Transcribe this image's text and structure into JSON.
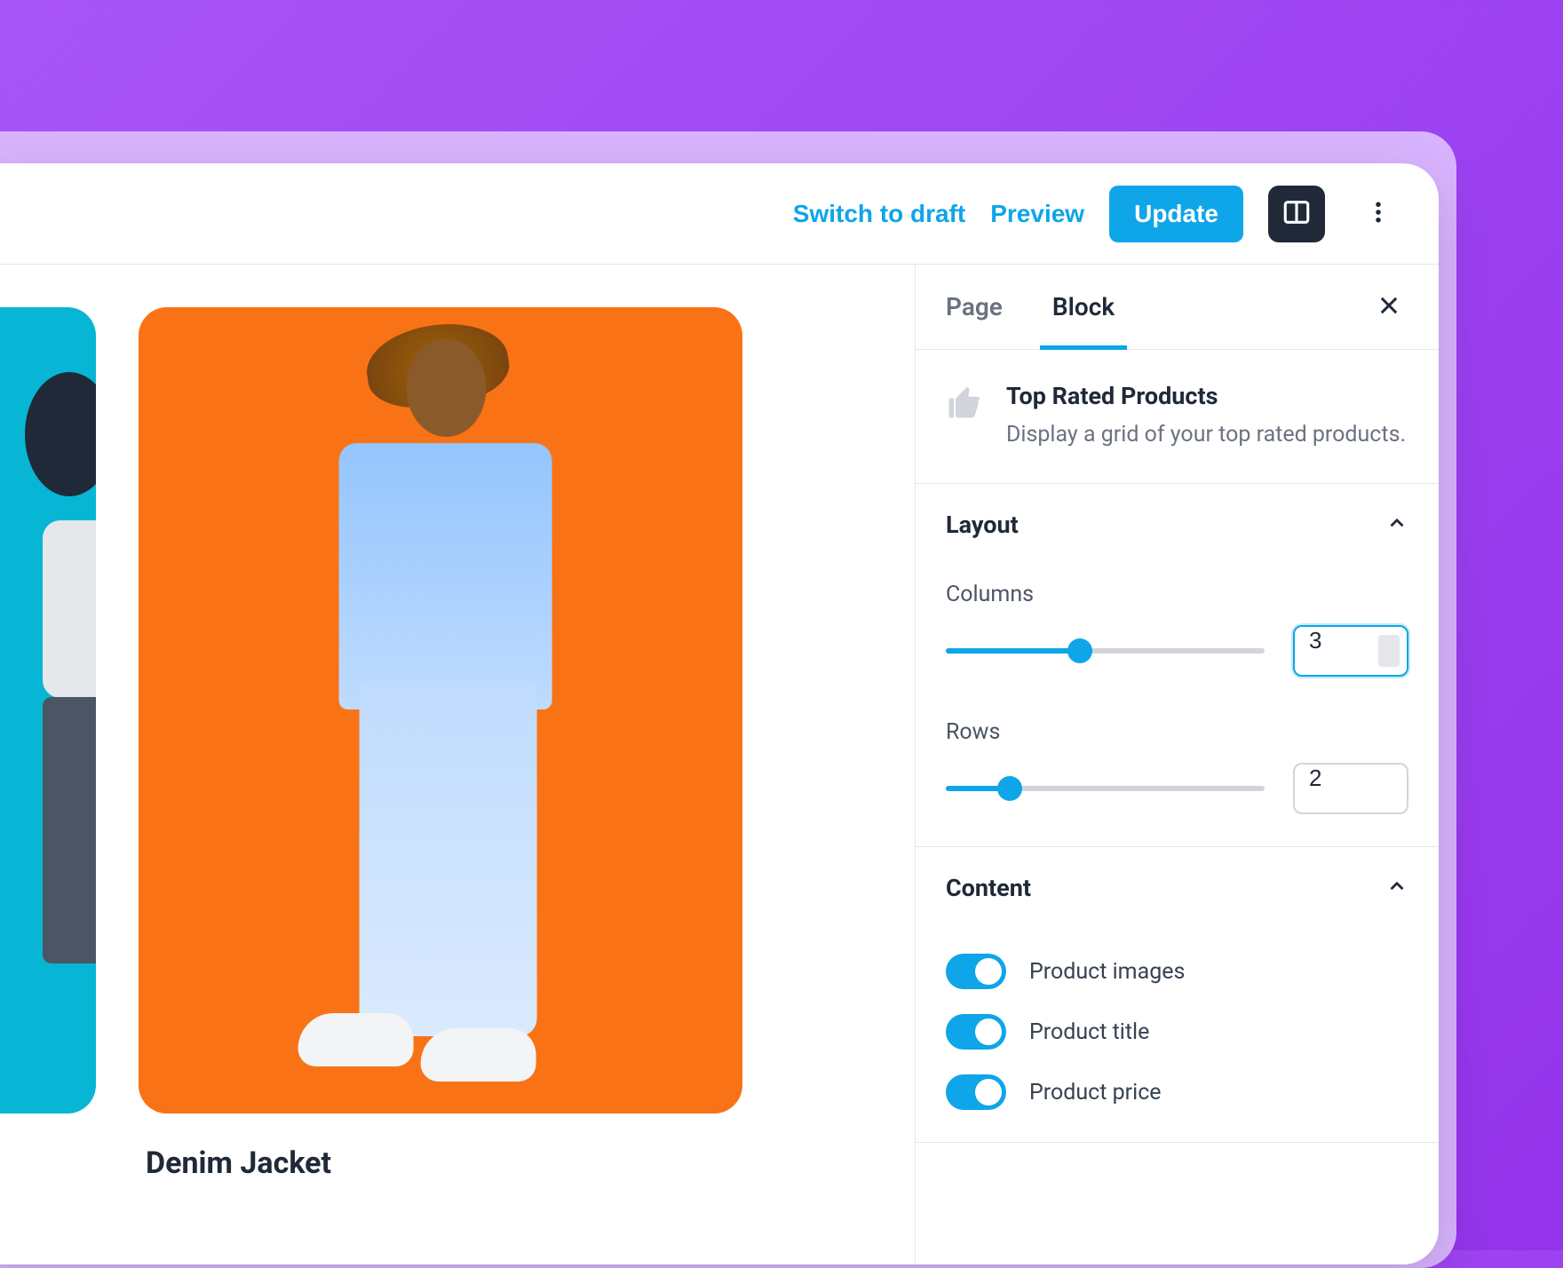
{
  "toolbar": {
    "switch_draft": "Switch to draft",
    "preview": "Preview",
    "update": "Update"
  },
  "tabs": {
    "page": "Page",
    "block": "Block"
  },
  "block": {
    "title": "Top Rated Products",
    "description": "Display a grid of your top rated products."
  },
  "sections": {
    "layout": {
      "title": "Layout",
      "columns_label": "Columns",
      "columns_value": "3",
      "rows_label": "Rows",
      "rows_value": "2"
    },
    "content": {
      "title": "Content",
      "toggles": [
        {
          "label": "Product images",
          "on": true
        },
        {
          "label": "Product title",
          "on": true
        },
        {
          "label": "Product price",
          "on": true
        }
      ]
    }
  },
  "product": {
    "title": "Denim Jacket"
  }
}
